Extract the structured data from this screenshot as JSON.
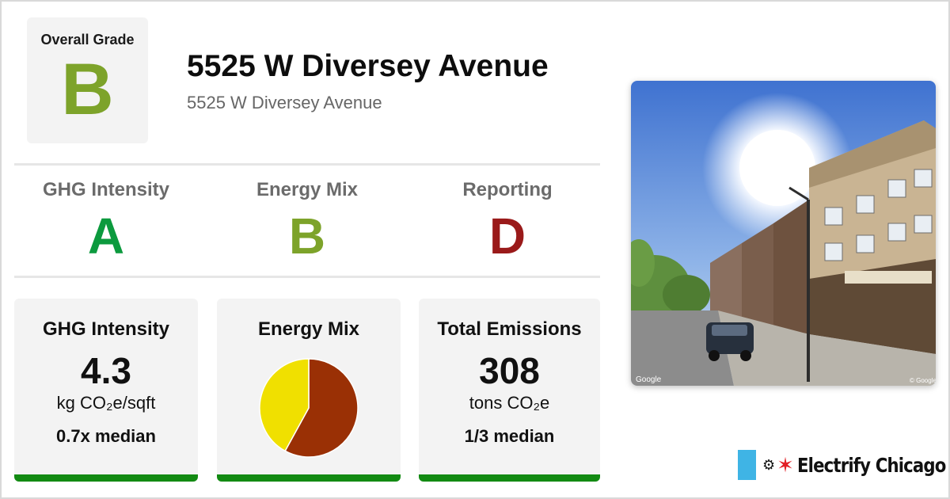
{
  "colors": {
    "grade_a": "#0c9a3e",
    "grade_b": "#7da32a",
    "grade_d": "#9a1a1a",
    "card_bar": "#128a12",
    "pie_primary": "#9a3005",
    "pie_secondary": "#f0e000",
    "flag_blue": "#3fb4e5",
    "star_red": "#e21f26"
  },
  "overall": {
    "label": "Overall Grade",
    "grade": "B"
  },
  "building": {
    "title": "5525 W Diversey Avenue",
    "address": "5525 W Diversey Avenue"
  },
  "grades": [
    {
      "label": "GHG Intensity",
      "grade": "A"
    },
    {
      "label": "Energy Mix",
      "grade": "B"
    },
    {
      "label": "Reporting",
      "grade": "D"
    }
  ],
  "cards": {
    "ghg": {
      "title": "GHG Intensity",
      "value": "4.3",
      "unit": "kg CO₂e/sqft",
      "median": "0.7x median"
    },
    "mix": {
      "title": "Energy Mix",
      "shares": [
        0.58,
        0.42
      ]
    },
    "emissions": {
      "title": "Total Emissions",
      "value": "308",
      "unit": "tons CO₂e",
      "median": "1/3 median"
    }
  },
  "photo": {
    "credit_left": "Google",
    "credit_right": "© Google"
  },
  "brand": {
    "icon": "plug-icon",
    "name": "Electrify Chicago"
  }
}
